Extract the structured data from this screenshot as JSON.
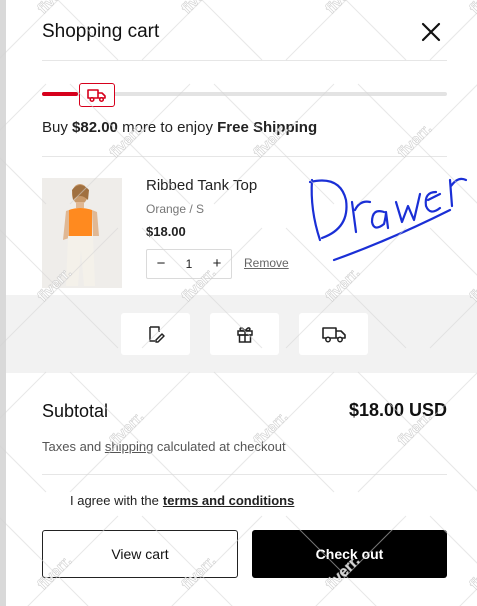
{
  "cart": {
    "title": "Shopping cart",
    "close_icon": "close-icon"
  },
  "shipping": {
    "prefix": "Buy ",
    "amount": "$82.00",
    "middle": " more to enjoy ",
    "highlight": "Free Shipping",
    "progress_fraction": 0.09,
    "accent_color": "#d6001c",
    "icon": "truck-icon"
  },
  "item": {
    "name": "Ribbed Tank Top",
    "variant": "Orange / S",
    "price": "$18.00",
    "quantity": "1",
    "decrease_label": "−",
    "increase_label": "+",
    "remove_label": "Remove"
  },
  "tools": [
    {
      "icon": "note-edit-icon"
    },
    {
      "icon": "gift-icon"
    },
    {
      "icon": "truck-icon"
    }
  ],
  "summary": {
    "subtotal_label": "Subtotal",
    "subtotal_value": "$18.00 USD",
    "tax_before": "Taxes and ",
    "tax_link": "shipping",
    "tax_after": " calculated at checkout"
  },
  "agreement": {
    "text": "I agree with the",
    "link": "terms and conditions"
  },
  "buttons": {
    "view_cart": "View cart",
    "checkout": "Check out"
  },
  "overlay": {
    "watermark": "fiverr.",
    "signature": "Drawer"
  }
}
